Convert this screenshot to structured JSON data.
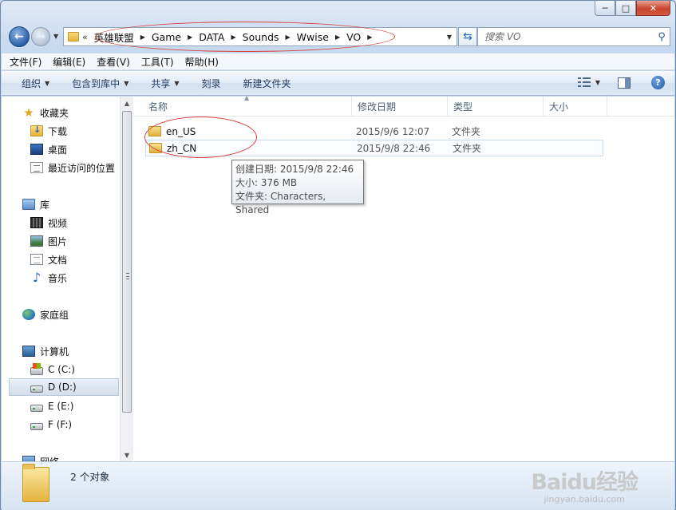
{
  "window": {
    "minimize_label": "─",
    "maximize_label": "□",
    "close_label": "✕"
  },
  "nav": {
    "back_label": "←",
    "forward_label": "→"
  },
  "address": {
    "overflow": "«",
    "crumbs": [
      "英雄联盟",
      "Game",
      "DATA",
      "Sounds",
      "Wwise",
      "VO"
    ]
  },
  "search": {
    "placeholder": "搜索 VO"
  },
  "menubar": {
    "items": [
      "文件(F)",
      "编辑(E)",
      "查看(V)",
      "工具(T)",
      "帮助(H)"
    ]
  },
  "toolbar": {
    "organize": "组织",
    "include_in_library": "包含到库中",
    "share": "共享",
    "burn": "刻录",
    "new_folder": "新建文件夹"
  },
  "navpane": {
    "favorites": "收藏夹",
    "downloads": "下载",
    "desktop": "桌面",
    "recent": "最近访问的位置",
    "libraries": "库",
    "videos": "视频",
    "pictures": "图片",
    "documents": "文档",
    "music": "音乐",
    "homegroup": "家庭组",
    "computer": "计算机",
    "drive_c": "C (C:)",
    "drive_d": "D (D:)",
    "drive_e": "E (E:)",
    "drive_f": "F (F:)",
    "network": "网络"
  },
  "columns": {
    "name": "名称",
    "modified": "修改日期",
    "type": "类型",
    "size": "大小"
  },
  "files": [
    {
      "name": "en_US",
      "modified": "2015/9/6 12:07",
      "type": "文件夹"
    },
    {
      "name": "zh_CN",
      "modified": "2015/9/8 22:46",
      "type": "文件夹"
    }
  ],
  "tooltip": {
    "created": "创建日期: 2015/9/8 22:46",
    "size": "大小: 376 MB",
    "folders": "文件夹: Characters, Shared"
  },
  "status": {
    "count": "2 个对象"
  },
  "watermark": {
    "main": "Baidu经验",
    "sub": "jingyan.baidu.com"
  },
  "colors": {
    "annotation": "#d9403a",
    "accent": "#2a5fa8"
  }
}
